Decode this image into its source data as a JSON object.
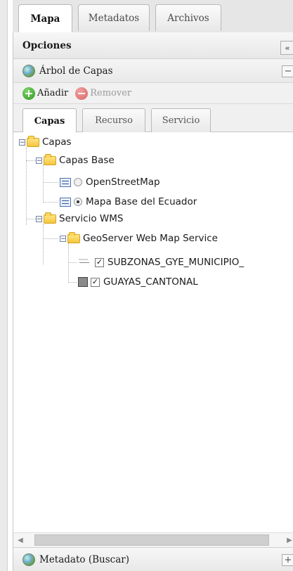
{
  "tabs": {
    "items": [
      "Mapa",
      "Metadatos",
      "Archivos"
    ],
    "active": 0
  },
  "panel": {
    "title": "Opciones",
    "collapse_label": "«"
  },
  "layer_tree_section": {
    "title": "Árbol de Capas",
    "collapse_label": "−",
    "icon": "globe-icon"
  },
  "toolbar": {
    "add_label": "Añadir",
    "remove_label": "Remover",
    "add_icon": "plus-circle-icon",
    "remove_icon": "minus-circle-icon"
  },
  "subtabs": {
    "items": [
      "Capas",
      "Recurso",
      "Servicio"
    ],
    "active": 0
  },
  "tree": {
    "root": "Capas",
    "base_group": "Capas Base",
    "base_layers": [
      "OpenStreetMap",
      "Mapa Base del Ecuador"
    ],
    "selected_base_layer": "Mapa Base del Ecuador",
    "wms_group": "Servicio WMS",
    "service_node": "GeoServer Web Map Service",
    "service_layers": [
      "SUBZONAS_GYE_MUNICIPIO_",
      "GUAYAS_CANTONAL"
    ],
    "checked_layers": [
      "SUBZONAS_GYE_MUNICIPIO_",
      "GUAYAS_CANTONAL"
    ]
  },
  "scrollbar": {
    "left_arrow": "◀",
    "right_arrow": "▶"
  },
  "metadata_section": {
    "title": "Metadato (Buscar)",
    "expand_label": "+",
    "icon": "globe-icon"
  },
  "colors": {
    "panel_bg": "#ffffff",
    "header_bg": "#e8e8e8",
    "folder": "#f3c63d",
    "add_green": "#2f9a21",
    "remove_red": "#d86464"
  }
}
